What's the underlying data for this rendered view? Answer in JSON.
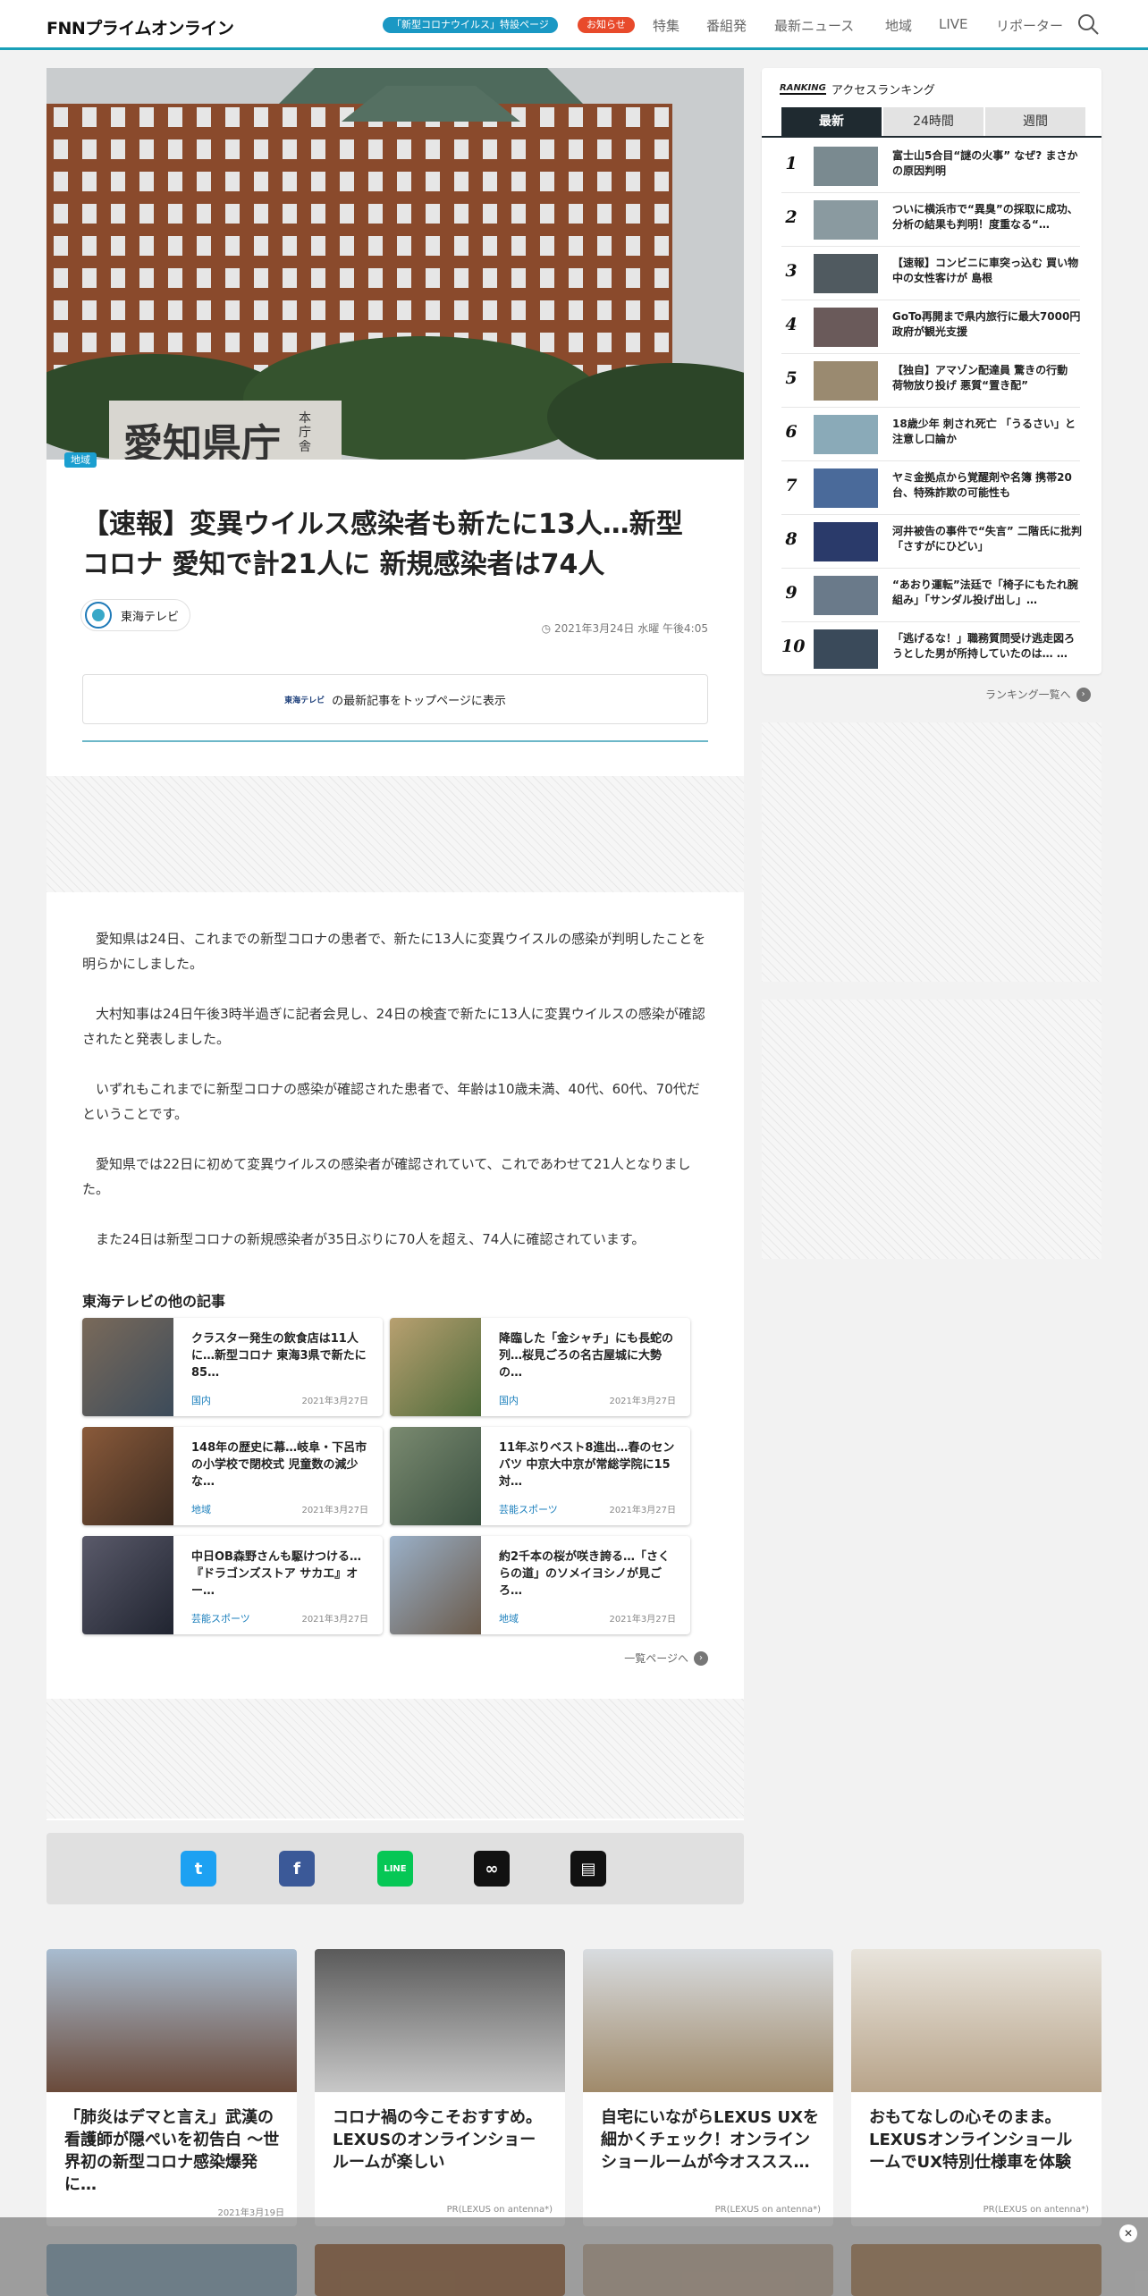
{
  "header": {
    "logo": "FNNプライムオンライン",
    "pill_corona": "「新型コロナウイルス」特設ページ",
    "pill_notice": "お知らせ",
    "nav": [
      "特集",
      "番組発",
      "最新ニュース",
      "地域",
      "LIVE",
      "リポーター"
    ]
  },
  "article": {
    "category": "地域",
    "title": "【速報】変異ウイルス感染者も新たに13人…新型コロナ 愛知で計21人に 新規感染者は74人",
    "source": "東海テレビ",
    "date": "2021年3月24日 水曜 午後4:05",
    "top_btn_logo": "東海テレビ",
    "top_btn_label": "の最新記事をトップページに表示",
    "paragraphs": [
      "愛知県は24日、これまでの新型コロナの患者で、新たに13人に変異ウイスルの感染が判明したことを明らかにしました。",
      "大村知事は24日午後3時半過ぎに記者会見し、24日の検査で新たに13人に変異ウイルスの感染が確認されたと発表しました。",
      "いずれもこれまでに新型コロナの感染が確認された患者で、年齢は10歳未満、40代、60代、70代だということです。",
      "愛知県では22日に初めて変異ウイルスの感染者が確認されていて、これであわせて21人となりました。",
      "また24日は新型コロナの新規感染者が35日ぶりに70人を超え、74人に確認されています。"
    ],
    "hero_sign": "愛知県庁",
    "hero_sign_sub": "本庁舎"
  },
  "other": {
    "heading": "東海テレビの他の記事",
    "more": "一覧ページへ",
    "cards": [
      {
        "title": "クラスター発生の飲食店は11人に…新型コロナ 東海3県で新たに85…",
        "category": "国内",
        "date": "2021年3月27日"
      },
      {
        "title": "降臨した「金シャチ」にも長蛇の列…桜見ごろの名古屋城に大勢の…",
        "category": "国内",
        "date": "2021年3月27日"
      },
      {
        "title": "148年の歴史に幕…岐阜・下呂市の小学校で閉校式 児童数の減少な…",
        "category": "地域",
        "date": "2021年3月27日"
      },
      {
        "title": "11年ぶりベスト8進出…春のセンバツ 中京大中京が常総学院に15対…",
        "category": "芸能スポーツ",
        "date": "2021年3月27日"
      },
      {
        "title": "中日OB森野さんも駆けつける…『ドラゴンズストア サカエ』オー…",
        "category": "芸能スポーツ",
        "date": "2021年3月27日"
      },
      {
        "title": "約2千本の桜が咲き誇る…「さくらの道」のソメイヨシノが見ごろ…",
        "category": "地域",
        "date": "2021年3月27日"
      }
    ]
  },
  "ranking": {
    "label": "アクセスランキング",
    "tag": "RANKING",
    "tabs": [
      "最新",
      "24時間",
      "週間"
    ],
    "more": "ランキング一覧へ",
    "items": [
      {
        "rank": "1",
        "text": "富士山5合目“謎の火事” なぜ? まさかの原因判明"
      },
      {
        "rank": "2",
        "text": "ついに横浜市で“異臭”の採取に成功、分析の結果も判明！度重なる“…"
      },
      {
        "rank": "3",
        "text": "【速報】コンビニに車突っ込む 買い物中の女性客けが 島根"
      },
      {
        "rank": "4",
        "text": "GoTo再開まで県内旅行に最大7000円 政府が観光支援"
      },
      {
        "rank": "5",
        "text": "【独自】アマゾン配達員 驚きの行動 荷物放り投げ 悪質“置き配”"
      },
      {
        "rank": "6",
        "text": "18歳少年 刺され死亡 「うるさい」と注意し口論か"
      },
      {
        "rank": "7",
        "text": "ヤミ金拠点から覚醒剤や名簿 携帯20台、特殊詐欺の可能性も"
      },
      {
        "rank": "8",
        "text": "河井被告の事件で“失言” 二階氏に批判「さすがにひどい」"
      },
      {
        "rank": "9",
        "text": "“あおり運転”法廷で「椅子にもたれ腕組み」「サンダル投げ出し」…"
      },
      {
        "rank": "10",
        "text": "「逃げるな！」職務質問受け逃走図ろうとした男が所持していたのは… …"
      }
    ]
  },
  "promos": [
    {
      "title": "「肺炎はデマと言え」武漢の看護師が隠ぺいを初告白 ～世界初の新型コロナ感染爆発に…",
      "footer": "2021年3月19日"
    },
    {
      "title": "コロナ禍の今こそおすすめ。LEXUSのオンラインショールームが楽しい",
      "footer": "PR(LEXUS on antenna*)"
    },
    {
      "title": "自宅にいながらLEXUS UXを細かくチェック！オンラインショールームが今オススス…",
      "footer": "PR(LEXUS on antenna*)"
    },
    {
      "title": "おもてなしの心そのまま。LEXUSオンラインショールームでUX特別仕様車を体験",
      "footer": "PR(LEXUS on antenna*)"
    }
  ],
  "colors": {
    "accent": "#1aa0b8",
    "notice": "#e84a2b",
    "link": "#1b7fbc"
  },
  "icons": {
    "search": "search-icon",
    "share": [
      "twitter-icon",
      "facebook-icon",
      "line-icon",
      "link-icon",
      "comment-icon"
    ]
  }
}
